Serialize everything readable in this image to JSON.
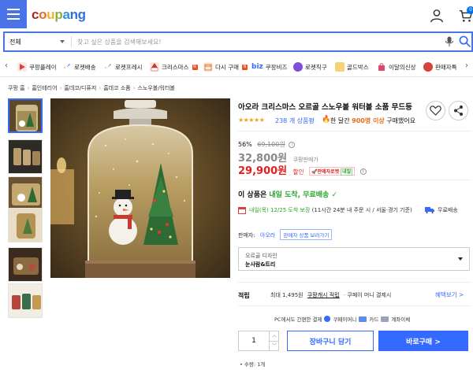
{
  "header": {
    "logo": [
      "c",
      "o",
      "u",
      "p",
      "a",
      "ng"
    ],
    "cart_count": "0"
  },
  "search": {
    "category": "전체",
    "placeholder": "찾고 싶은 상품을 검색해보세요!"
  },
  "category_bar": {
    "items": [
      {
        "label": "쿠팡플레이",
        "icon": "play-icon",
        "color": "#d9413d"
      },
      {
        "label": "로켓배송",
        "icon": "rocket-icon",
        "color": "#2f80ed"
      },
      {
        "label": "로켓프레시",
        "icon": "rocket-fresh-icon",
        "color": "#3cb34a"
      },
      {
        "label": "크리스마스",
        "icon": "santa-icon",
        "color": "#c93a2f",
        "badge": "N"
      },
      {
        "label": "다시 구매",
        "icon": "reorder-icon",
        "color": "#e5702a",
        "badge": "N"
      },
      {
        "label": "쿠팡비즈",
        "icon": "biz-icon",
        "color": "#346aff",
        "prefix": "biz"
      },
      {
        "label": "로켓직구",
        "icon": "globe-icon",
        "color": "#7b4fd8"
      },
      {
        "label": "골드박스",
        "icon": "gold-icon",
        "color": "#e6a817"
      },
      {
        "label": "이달의신상",
        "icon": "bag-icon",
        "color": "#d94a6b"
      },
      {
        "label": "판매자특",
        "icon": "seller-icon",
        "color": "#d9413d"
      }
    ]
  },
  "breadcrumb": [
    "쿠팡 홈",
    "홈인테리어",
    "홈데코/디퓨저",
    "홈데코 소품",
    "스노우볼/워터볼"
  ],
  "product": {
    "title": "아오라 크리스마스 오르골 스노우볼 워터볼 소품 무드등",
    "rating_stars": "★★★★★",
    "rating_value": 5,
    "review_count": "238 개 상품평",
    "month_prefix": "한 달간",
    "month_count": "900명 이상",
    "month_suffix": "구매했어요",
    "discount_rate": "56%",
    "original_price": "69,100원",
    "coupang_price": "32,800원",
    "coupang_price_label": "쿠팡판매가",
    "sale_price": "29,900원",
    "sale_label": "할인",
    "rocket_badge": "🚀판매자로켓",
    "rocket_badge_in": "내일",
    "arrival_prefix": "이 상품은",
    "arrival_highlight": "내일 도착, 무료배송",
    "delivery_highlight": "내일(목) 12/25 도착 보장",
    "delivery_rest": "(11시간 24분 내 주문 시 / 서울·경기 기준)",
    "free_shipping": "무료배송",
    "seller_label": "판매자:",
    "seller_name": "아오라",
    "seller_link": "판매자 상품 보러가기",
    "option_label": "오르골 디자인",
    "option_value": "눈사람&트리",
    "points_label": "적립",
    "points_text_1": "최대 1,495원",
    "points_link": "쿠팡캐시 적립",
    "points_text_2": "· 쿠페이 머니 결제시",
    "benefit_link": "혜택보기 >",
    "pay_text": "PC에서도 간편한 결제",
    "pay_coupay": "쿠페이머니",
    "pay_card": "카드",
    "pay_bank": "계좌이체",
    "quantity": "1",
    "cart_button": "장바구니 담기",
    "buy_button": "바로구매 >",
    "quantity_note": "• 수량: 1개"
  },
  "colors": {
    "brand_blue": "#346aff",
    "sale_red": "#e31e1e",
    "arrival_green": "#2ba52b",
    "star_orange": "#f0a01b"
  }
}
